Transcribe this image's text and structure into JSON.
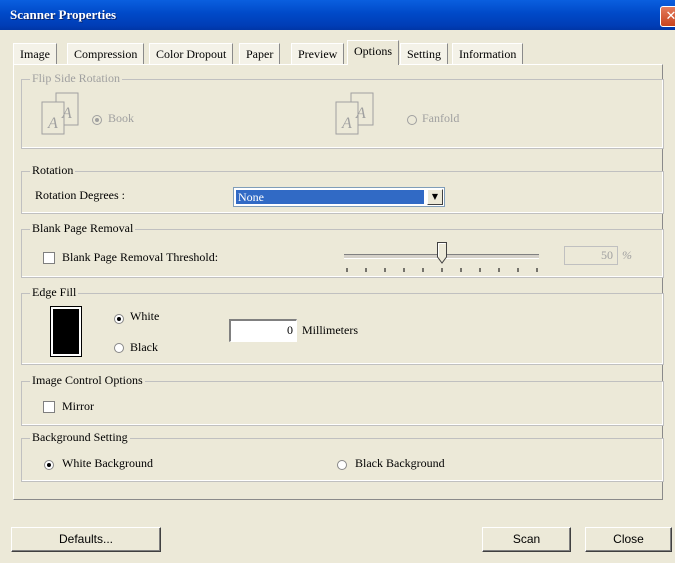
{
  "window": {
    "title": "Scanner Properties",
    "close_glyph": "✕"
  },
  "tabs": [
    {
      "label": "Image"
    },
    {
      "label": "Compression"
    },
    {
      "label": "Color Dropout"
    },
    {
      "label": "Paper"
    },
    {
      "label": "Preview"
    },
    {
      "label": "Options",
      "active": true
    },
    {
      "label": "Setting"
    },
    {
      "label": "Information"
    }
  ],
  "flip_side_rotation": {
    "title": "Flip Side Rotation",
    "book_label": "Book",
    "fanfold_label": "Fanfold",
    "selected": "Book",
    "enabled": false,
    "page_glyph": "A"
  },
  "rotation": {
    "title": "Rotation",
    "degrees_label": "Rotation Degrees :",
    "degrees_value": "None",
    "arrow_glyph": "▼"
  },
  "blank_page_removal": {
    "title": "Blank Page Removal",
    "checkbox_label": "Blank Page Removal Threshold:",
    "checked": false,
    "threshold_value": "50",
    "unit": "%",
    "threshold_fraction": 0.5
  },
  "edge_fill": {
    "title": "Edge Fill",
    "white_label": "White",
    "black_label": "Black",
    "selected": "White",
    "millimeters_value": "0",
    "millimeters_label": "Millimeters"
  },
  "image_control": {
    "title": "Image Control Options",
    "mirror_label": "Mirror",
    "mirror_checked": false
  },
  "background_setting": {
    "title": "Background Setting",
    "white_label": "White Background",
    "black_label": "Black Background",
    "selected": "White Background"
  },
  "buttons": {
    "defaults": "Defaults...",
    "scan": "Scan",
    "close": "Close"
  }
}
